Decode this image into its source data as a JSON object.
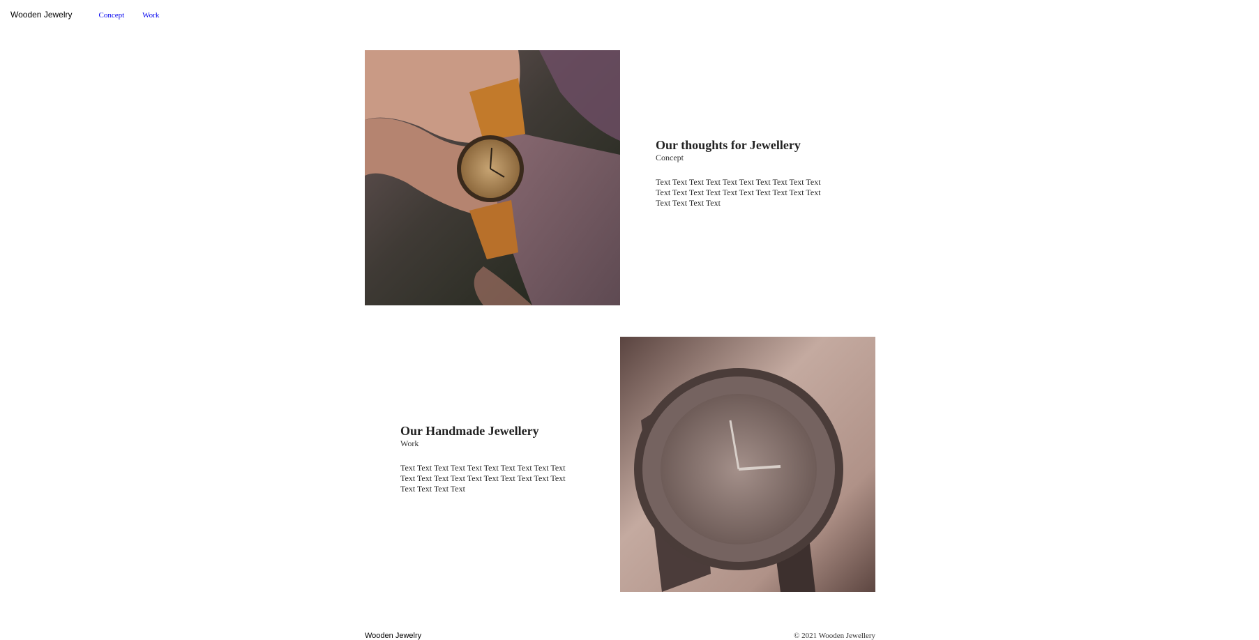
{
  "header": {
    "logo": "Wooden Jewelry",
    "nav": [
      {
        "label": "Concept"
      },
      {
        "label": "Work"
      }
    ]
  },
  "sections": [
    {
      "title": "Our thoughts for Jewellery",
      "subtitle": "Concept",
      "body": "Text Text Text Text Text Text Text Text Text Text Text Text Text Text Text Text Text Text Text Text Text Text Text Text"
    },
    {
      "title": "Our Handmade Jewellery",
      "subtitle": "Work",
      "body": "Text Text Text Text Text Text Text Text Text Text Text Text Text Text Text Text Text Text Text Text Text Text Text Text"
    }
  ],
  "footer": {
    "logo": "Wooden Jewelry",
    "copyright": "© 2021 Wooden Jewellery"
  }
}
